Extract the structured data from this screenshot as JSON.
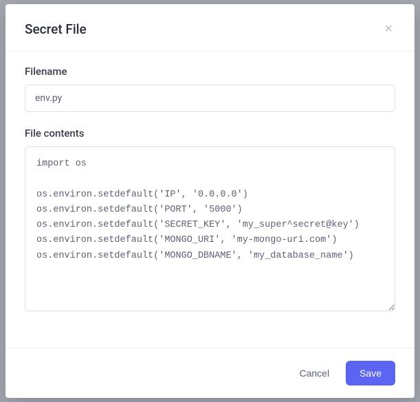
{
  "modal": {
    "title": "Secret File",
    "close_label": "×",
    "fields": {
      "filename": {
        "label": "Filename",
        "value": "env.py"
      },
      "contents": {
        "label": "File contents",
        "value": "import os\n\nos.environ.setdefault('IP', '0.0.0.0')\nos.environ.setdefault('PORT', '5000')\nos.environ.setdefault('SECRET_KEY', 'my_super^secret@key')\nos.environ.setdefault('MONGO_URI', 'my-mongo-uri.com')\nos.environ.setdefault('MONGO_DBNAME', 'my_database_name')"
      }
    },
    "footer": {
      "cancel_label": "Cancel",
      "save_label": "Save"
    }
  }
}
